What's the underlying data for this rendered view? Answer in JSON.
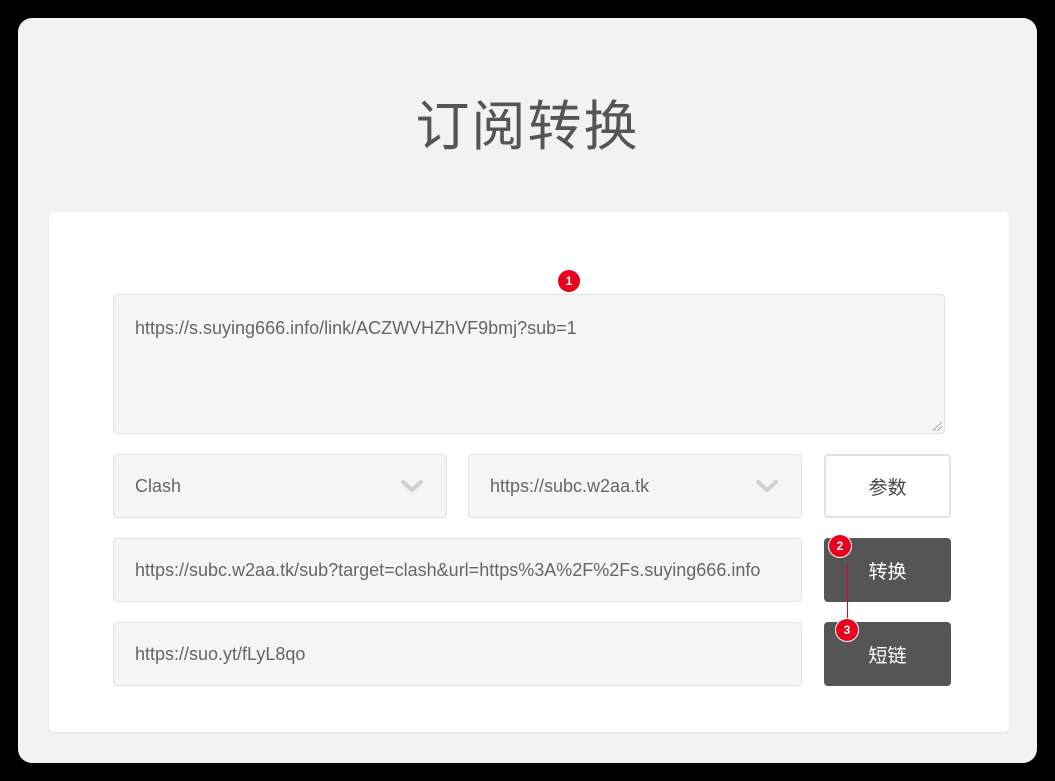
{
  "page": {
    "title": "订阅转换"
  },
  "form": {
    "subscription_url": "https://s.suying666.info/link/ACZWVHZhVF9bmj?sub=1",
    "target_select": "Clash",
    "backend_select": "https://subc.w2aa.tk",
    "params_button": "参数",
    "converted_url": "https://subc.w2aa.tk/sub?target=clash&url=https%3A%2F%2Fs.suying666.info",
    "convert_button": "转换",
    "short_url": "https://suo.yt/fLyL8qo",
    "shorten_button": "短链"
  },
  "annotations": {
    "badge1": "1",
    "badge2": "2",
    "badge3": "3"
  },
  "colors": {
    "accent_badge": "#e8001c",
    "dark_button": "#555555"
  },
  "icons": {
    "select_arrow": "chevron-down-icon"
  }
}
